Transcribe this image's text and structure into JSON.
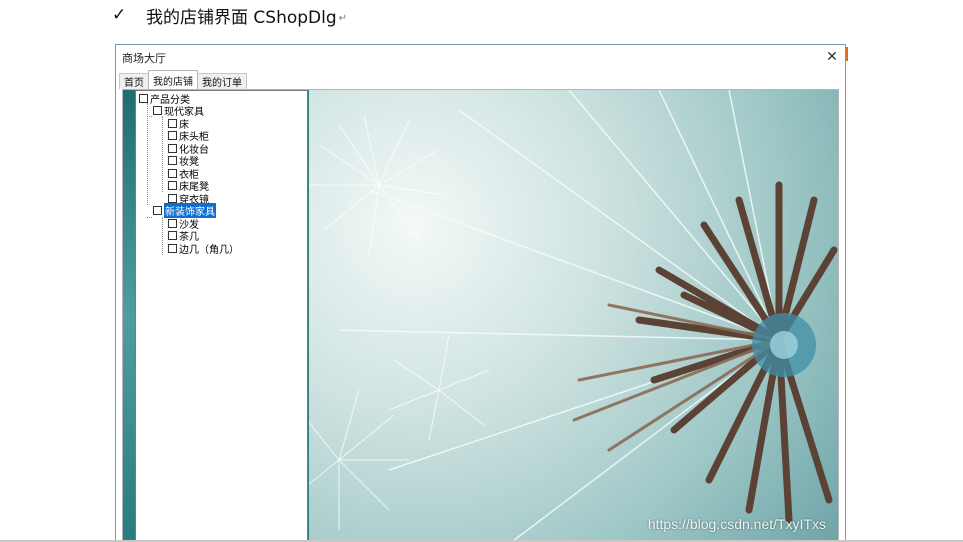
{
  "doc": {
    "heading": "我的店铺界面 CShopDlg",
    "check_glyph": "✓",
    "para_mark": "↵"
  },
  "window": {
    "title": "商场大厅",
    "close_glyph": "✕"
  },
  "tabs": [
    {
      "label": "首页",
      "active": false
    },
    {
      "label": "我的店铺",
      "active": true
    },
    {
      "label": "我的订单",
      "active": false
    }
  ],
  "tree": {
    "root": "产品分类",
    "groups": [
      {
        "label": "现代家具",
        "selected": false,
        "children": [
          "床",
          "床头柜",
          "化妆台",
          "妆凳",
          "衣柜",
          "床尾凳",
          "穿衣镜"
        ]
      },
      {
        "label": "新装饰家具",
        "selected": true,
        "children": [
          "沙发",
          "茶几",
          "边几（角几）"
        ]
      }
    ]
  },
  "image": {
    "subject": "dandelion-seed-head",
    "watermark": "https://blog.csdn.net/TxyITxs"
  },
  "colors": {
    "selection": "#0f6fd0",
    "window_border": "#7a96b4",
    "accent_orange": "#e36d1c"
  }
}
